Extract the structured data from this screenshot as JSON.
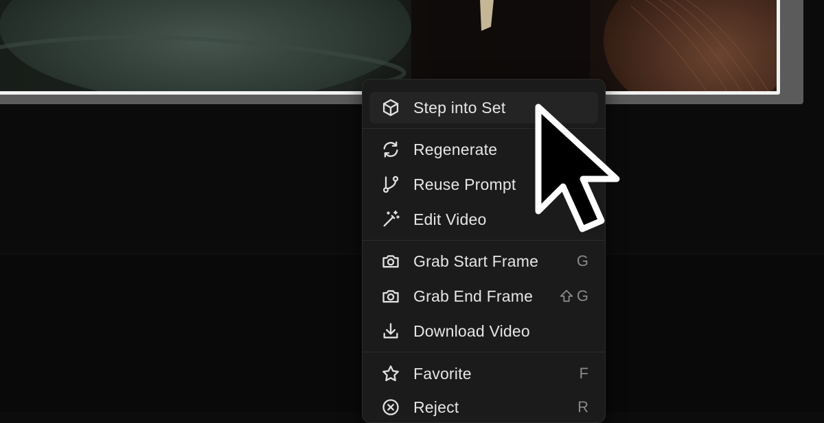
{
  "menu": {
    "items": [
      {
        "label": "Step into Set",
        "icon": "cube-icon",
        "shortcut": "",
        "highlighted": true
      },
      {
        "label": "Regenerate",
        "icon": "refresh-icon",
        "shortcut": ""
      },
      {
        "label": "Reuse Prompt",
        "icon": "branch-icon",
        "shortcut": ""
      },
      {
        "label": "Edit Video",
        "icon": "magic-wand-icon",
        "shortcut": ""
      },
      {
        "label": "Grab Start Frame",
        "icon": "camera-icon",
        "shortcut": "G"
      },
      {
        "label": "Grab End Frame",
        "icon": "camera-icon",
        "shortcut": "G",
        "shortcut_modifier": "shift-icon"
      },
      {
        "label": "Download Video",
        "icon": "download-icon",
        "shortcut": ""
      },
      {
        "label": "Favorite",
        "icon": "star-icon",
        "shortcut": "F"
      },
      {
        "label": "Reject",
        "icon": "x-circle-icon",
        "shortcut": "R"
      }
    ]
  },
  "colors": {
    "menu_background": "#1b1b1b",
    "menu_text": "#e6e6e6",
    "shortcut_text": "#8a8a8a",
    "selection_border": "#f2f2f2",
    "app_background": "#0b0b0b"
  }
}
